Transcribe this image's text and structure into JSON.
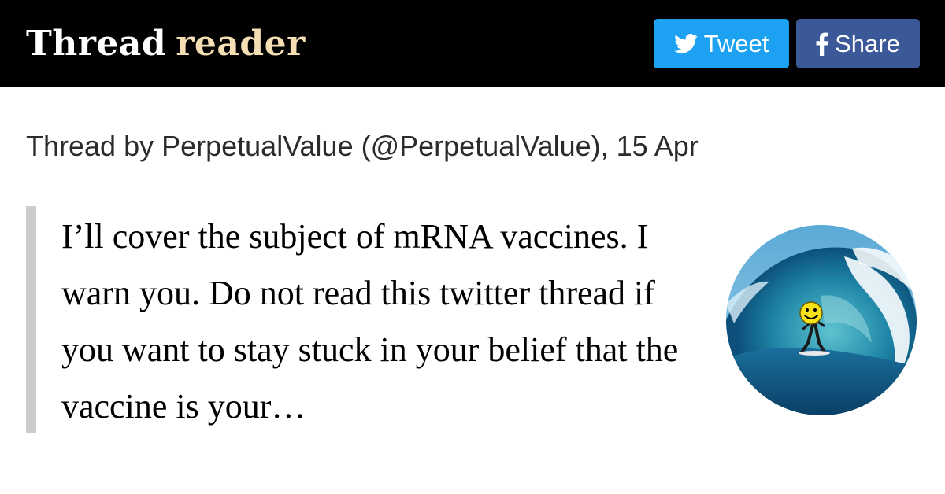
{
  "header": {
    "logo_part1": "Thread",
    "logo_part2": "reader",
    "tweet_label": "Tweet",
    "share_label": "Share",
    "colors": {
      "background": "#000000",
      "logo_accent": "#f5deb3",
      "tweet": "#1da1f2",
      "share": "#3b5998"
    }
  },
  "thread": {
    "meta": "Thread by PerpetualValue (@PerpetualValue), 15 Apr",
    "text": "I’ll cover the subject of mRNA vaccines. I warn you. Do not read this twitter thread if you want to stay stuck in your belief that the vaccine is your…"
  },
  "avatar": {
    "icon": "wave-surfer-smiley-avatar"
  }
}
